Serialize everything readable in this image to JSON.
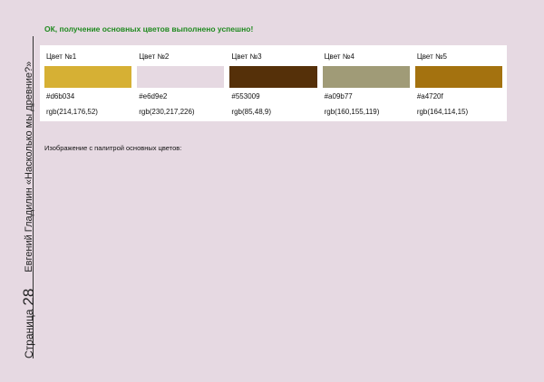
{
  "sidebar": {
    "page_label": "Страница",
    "page_number": "28",
    "book_title": "Евгений Гладилин «Насколько мы древние?»"
  },
  "status_message": "ОК, получение основных цветов выполнено успешно!",
  "palette": {
    "colors": [
      {
        "label": "Цвет №1",
        "hex": "#d6b034",
        "rgb": "rgb(214,176,52)",
        "swatch": "#d6b034"
      },
      {
        "label": "Цвет №2",
        "hex": "#e6d9e2",
        "rgb": "rgb(230,217,226)",
        "swatch": "#e6d9e2"
      },
      {
        "label": "Цвет №3",
        "hex": "#553009",
        "rgb": "rgb(85,48,9)",
        "swatch": "#553009"
      },
      {
        "label": "Цвет №4",
        "hex": "#a09b77",
        "rgb": "rgb(160,155,119)",
        "swatch": "#a09b77"
      },
      {
        "label": "Цвет №5",
        "hex": "#a4720f",
        "rgb": "rgb(164,114,15)",
        "swatch": "#a4720f"
      }
    ]
  },
  "image_caption": "Изображение с палитрой основных цветов:",
  "theme": {
    "page_background": "#e6d9e2",
    "status_color": "#1f8a1f"
  }
}
